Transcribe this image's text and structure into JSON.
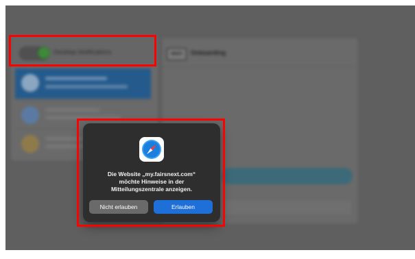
{
  "left_panel": {
    "toggle_label": "Desktop Notifications",
    "toggle_on": true
  },
  "chat": {
    "logo_text": "MONTI",
    "title": "Onboarding"
  },
  "dialog": {
    "message": "Die Website „my.fairsnext.com“\nmöchte Hinweise in der\nMitteilungszentrale anzeigen.",
    "deny_label": "Nicht erlauben",
    "allow_label": "Erlauben",
    "icon": "safari-compass-icon"
  },
  "colors": {
    "toggle_on": "#3f8a3a",
    "allow_button": "#1f6fd9",
    "highlight": "#ff0000"
  }
}
